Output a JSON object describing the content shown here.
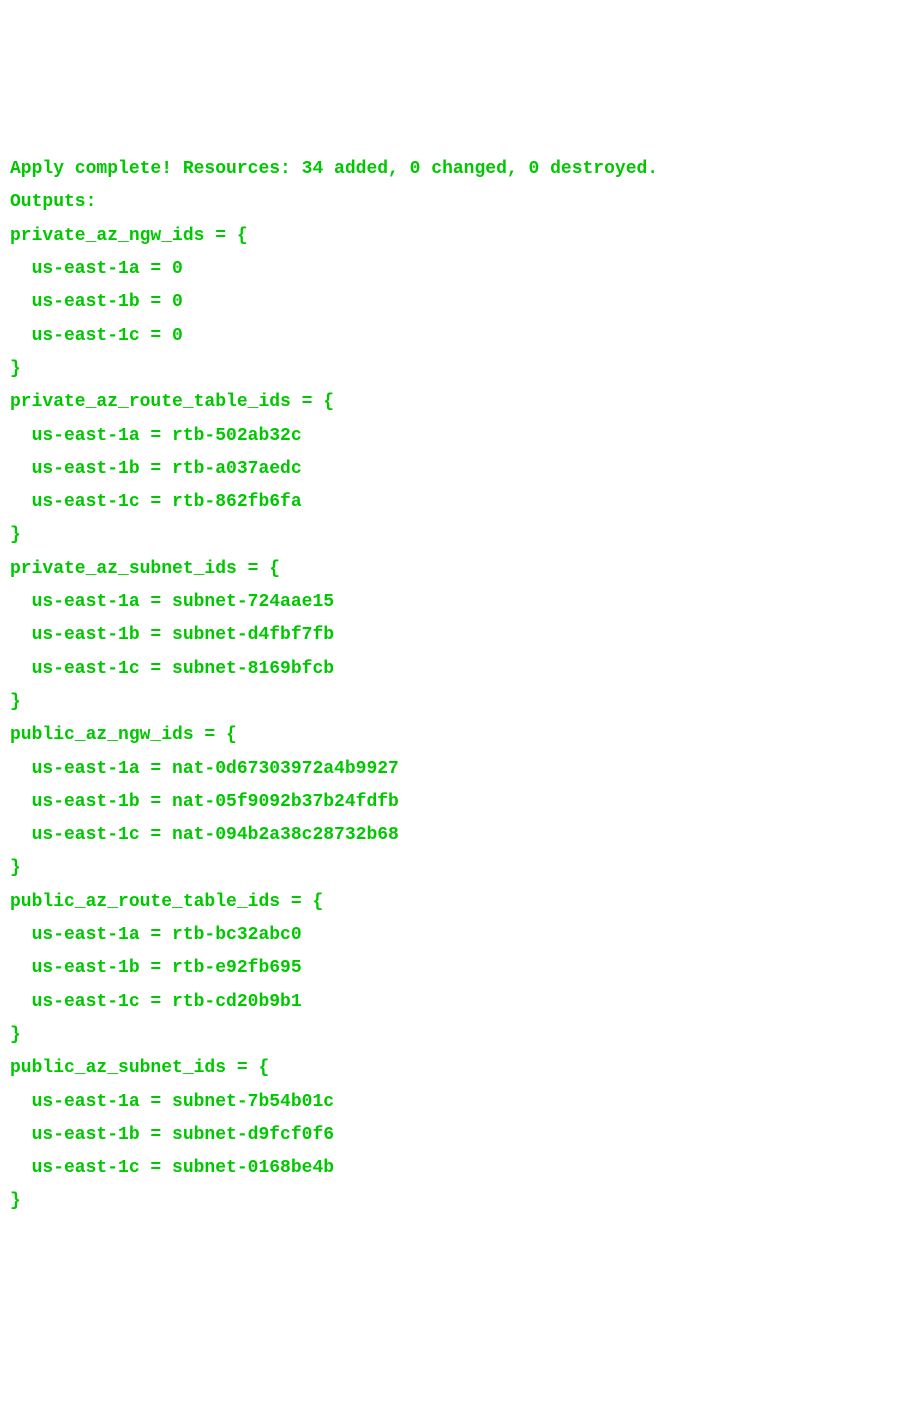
{
  "apply_line": "Apply complete! Resources: 34 added, 0 changed, 0 destroyed.",
  "blank1": "",
  "outputs_header": "Outputs:",
  "blank2": "",
  "private_az_ngw_ids_open": "private_az_ngw_ids = {",
  "private_az_ngw_ids_1": "  us-east-1a = 0",
  "private_az_ngw_ids_2": "  us-east-1b = 0",
  "private_az_ngw_ids_3": "  us-east-1c = 0",
  "private_az_ngw_ids_close": "}",
  "private_az_route_table_ids_open": "private_az_route_table_ids = {",
  "private_az_route_table_ids_1": "  us-east-1a = rtb-502ab32c",
  "private_az_route_table_ids_2": "  us-east-1b = rtb-a037aedc",
  "private_az_route_table_ids_3": "  us-east-1c = rtb-862fb6fa",
  "private_az_route_table_ids_close": "}",
  "private_az_subnet_ids_open": "private_az_subnet_ids = {",
  "private_az_subnet_ids_1": "  us-east-1a = subnet-724aae15",
  "private_az_subnet_ids_2": "  us-east-1b = subnet-d4fbf7fb",
  "private_az_subnet_ids_3": "  us-east-1c = subnet-8169bfcb",
  "private_az_subnet_ids_close": "}",
  "public_az_ngw_ids_open": "public_az_ngw_ids = {",
  "public_az_ngw_ids_1": "  us-east-1a = nat-0d67303972a4b9927",
  "public_az_ngw_ids_2": "  us-east-1b = nat-05f9092b37b24fdfb",
  "public_az_ngw_ids_3": "  us-east-1c = nat-094b2a38c28732b68",
  "public_az_ngw_ids_close": "}",
  "public_az_route_table_ids_open": "public_az_route_table_ids = {",
  "public_az_route_table_ids_1": "  us-east-1a = rtb-bc32abc0",
  "public_az_route_table_ids_2": "  us-east-1b = rtb-e92fb695",
  "public_az_route_table_ids_3": "  us-east-1c = rtb-cd20b9b1",
  "public_az_route_table_ids_close": "}",
  "public_az_subnet_ids_open": "public_az_subnet_ids = {",
  "public_az_subnet_ids_1": "  us-east-1a = subnet-7b54b01c",
  "public_az_subnet_ids_2": "  us-east-1b = subnet-d9fcf0f6",
  "public_az_subnet_ids_3": "  us-east-1c = subnet-0168be4b",
  "public_az_subnet_ids_close": "}"
}
